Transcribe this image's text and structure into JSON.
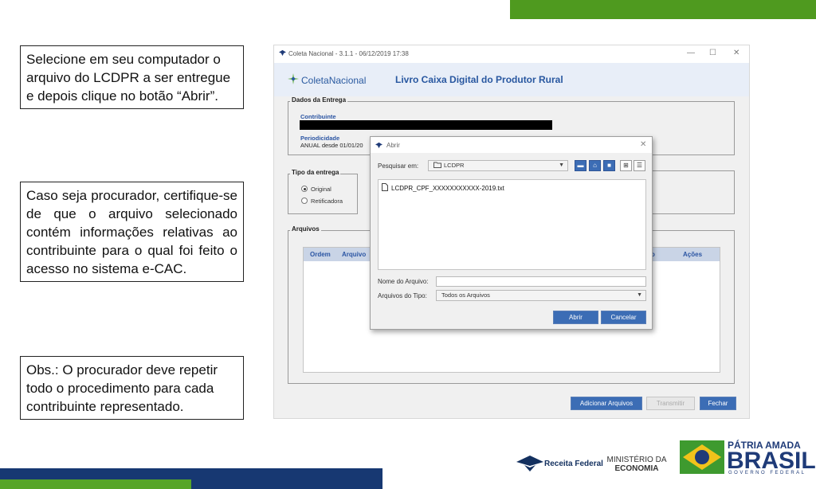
{
  "instructions": {
    "step1": "Selecione em seu computador o arquivo do LCDPR a ser entregue e depois clique no botão “Abrir”.",
    "step2": "Caso seja procurador, certifique-se de que o arquivo selecionado contém informações relativas ao contribuinte para o qual foi feito o acesso no sistema e-CAC.",
    "obs": "Obs.: O procurador deve repetir todo o procedimento para cada contribuinte representado."
  },
  "app": {
    "window_title": "Coleta Nacional - 3.1.1 - 06/12/2019 17:38",
    "logo_text": "ColetaNacional",
    "title": "Livro Caixa Digital do Produtor Rural",
    "dados": {
      "legend": "Dados da Entrega",
      "contribuinte_label": "Contribuinte",
      "periodicidade_label": "Periodicidade",
      "periodicidade_value": "ANUAL desde 01/01/20"
    },
    "tipo": {
      "legend": "Tipo da entrega",
      "original": "Original",
      "retificadora": "Retificadora"
    },
    "arquivos": {
      "legend": "Arquivos",
      "columns": [
        "Ordem",
        "Arquivo",
        "o",
        "Ações"
      ]
    },
    "buttons": {
      "adicionar": "Adicionar Arquivos",
      "transmitir": "Transmitir",
      "fechar": "Fechar"
    }
  },
  "dialog": {
    "title": "Abrir",
    "pesquisar_label": "Pesquisar em:",
    "folder": "LCDPR",
    "files": [
      "LCDPR_CPF_XXXXXXXXXXX-2019.txt"
    ],
    "nome_label": "Nome do Arquivo:",
    "nome_value": "",
    "tipo_label": "Arquivos do Tipo:",
    "tipo_value": "Todos os Arquivos",
    "abrir": "Abrir",
    "cancelar": "Cancelar"
  },
  "footer": {
    "receita": "Receita Federal",
    "ministerio_line1": "MINISTÉRIO DA",
    "ministerio_line2": "ECONOMIA",
    "patria_line1": "PÁTRIA AMADA",
    "patria_line2": "BRASIL",
    "patria_line3": "GOVERNO FEDERAL"
  },
  "colors": {
    "accent_green": "#4f9a1f",
    "navy": "#173872",
    "button_blue": "#3c6db5"
  }
}
